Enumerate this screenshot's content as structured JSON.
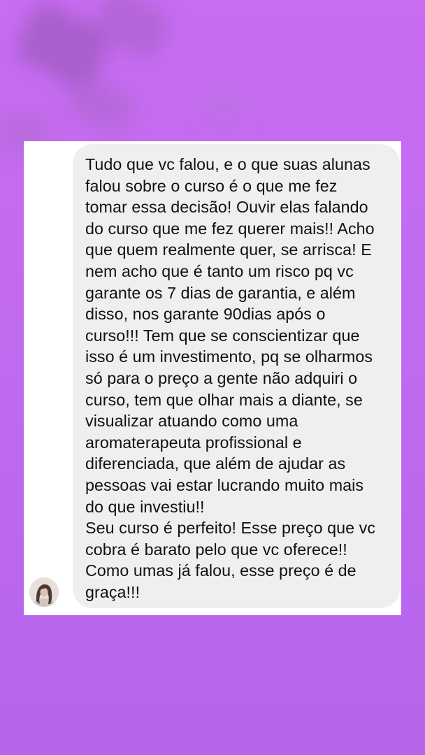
{
  "message": {
    "lines": [
      "Tudo que vc falou, e o que suas alunas",
      "falou sobre o curso é o que me fez",
      "tomar essa decisão! Ouvir elas falando",
      "do curso que me fez querer mais!! Acho",
      "que quem realmente quer, se arrisca! E",
      "nem acho que é tanto um risco pq vc",
      "garante os 7 dias de garantia, e além",
      "disso, nos garante 90dias após o",
      "curso!!! Tem que se conscientizar que",
      "isso é um investimento, pq se olharmos",
      "só para o preço a gente não adquiri o",
      "curso, tem que olhar mais a diante, se",
      "visualizar atuando como uma",
      "aromaterapeuta profissional e",
      "diferenciada, que além de ajudar as",
      "pessoas vai estar lucrando muito mais",
      "do que investiu!!",
      "Seu curso é perfeito! Esse preço que vc",
      "cobra é barato pelo que vc oferece!!",
      "Como umas já falou, esse preço é de",
      "graça!!!"
    ]
  },
  "colors": {
    "background": "#c06af0",
    "bubble": "#efefef",
    "text": "#111111",
    "card": "#ffffff"
  },
  "icons": {
    "avatar": "user-avatar-photo"
  }
}
